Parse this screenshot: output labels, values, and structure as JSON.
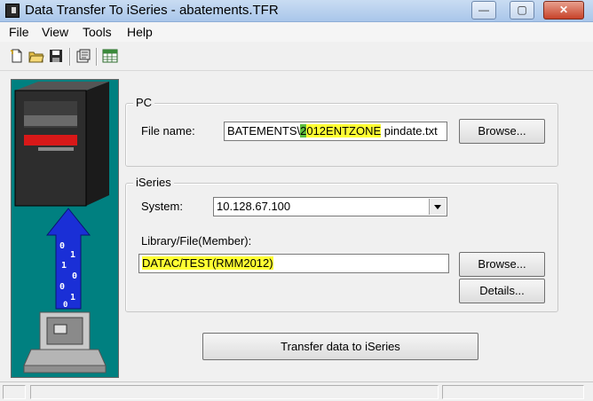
{
  "window": {
    "title": "Data Transfer To iSeries - abatements.TFR",
    "controls": {
      "minimize": "—",
      "maximize": "▢",
      "close": "✕"
    }
  },
  "menu": [
    "File",
    "View",
    "Tools",
    "Help"
  ],
  "toolbar": {
    "icons": [
      "new-icon",
      "open-icon",
      "save-icon",
      "properties-icon",
      "spreadsheet-icon"
    ]
  },
  "pc": {
    "label": "PC",
    "file_name_label": "File name:",
    "file_name_pre": "BATEMENTS\\",
    "file_name_cursor": "2",
    "file_name_highlight": "012ENTZONE",
    "file_name_post": " pindate.txt",
    "browse_label": "Browse..."
  },
  "iseries": {
    "label": "iSeries",
    "system_label": "System:",
    "system_value": "10.128.67.100",
    "library_label": "Library/File(Member):",
    "library_value": "DATAC/TEST(RMM2012)",
    "browse_label": "Browse...",
    "details_label": "Details..."
  },
  "transfer_button": "Transfer data to iSeries",
  "colors": {
    "highlight": "#ffff33",
    "panel_bg": "#008080"
  }
}
